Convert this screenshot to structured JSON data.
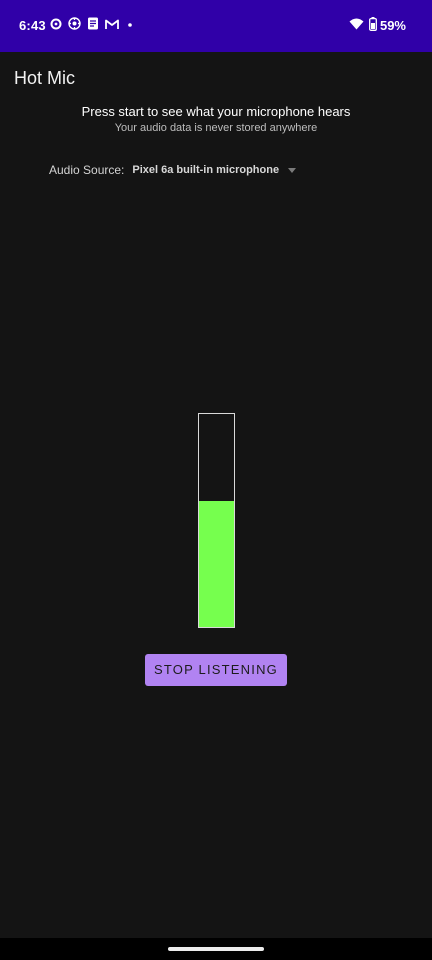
{
  "status_bar": {
    "time": "6:43",
    "battery_percent": "59%",
    "left_icons": [
      "record-icon",
      "settings-icon",
      "document-icon",
      "gmail-icon",
      "notification-dot-icon"
    ],
    "right_icons": [
      "wifi-icon",
      "battery-icon"
    ],
    "background_color": "#3000a8"
  },
  "app": {
    "title": "Hot Mic"
  },
  "intro": {
    "headline": "Press start to see what your microphone hears",
    "subline": "Your audio data is never stored anywhere"
  },
  "audio_source": {
    "label": "Audio Source:",
    "selected": "Pixel 6a built-in microphone"
  },
  "level_meter": {
    "level_fraction": 0.59,
    "fill_color": "#76ff4e"
  },
  "actions": {
    "stop_label": "STOP LISTENING",
    "button_color": "#b183f2"
  }
}
